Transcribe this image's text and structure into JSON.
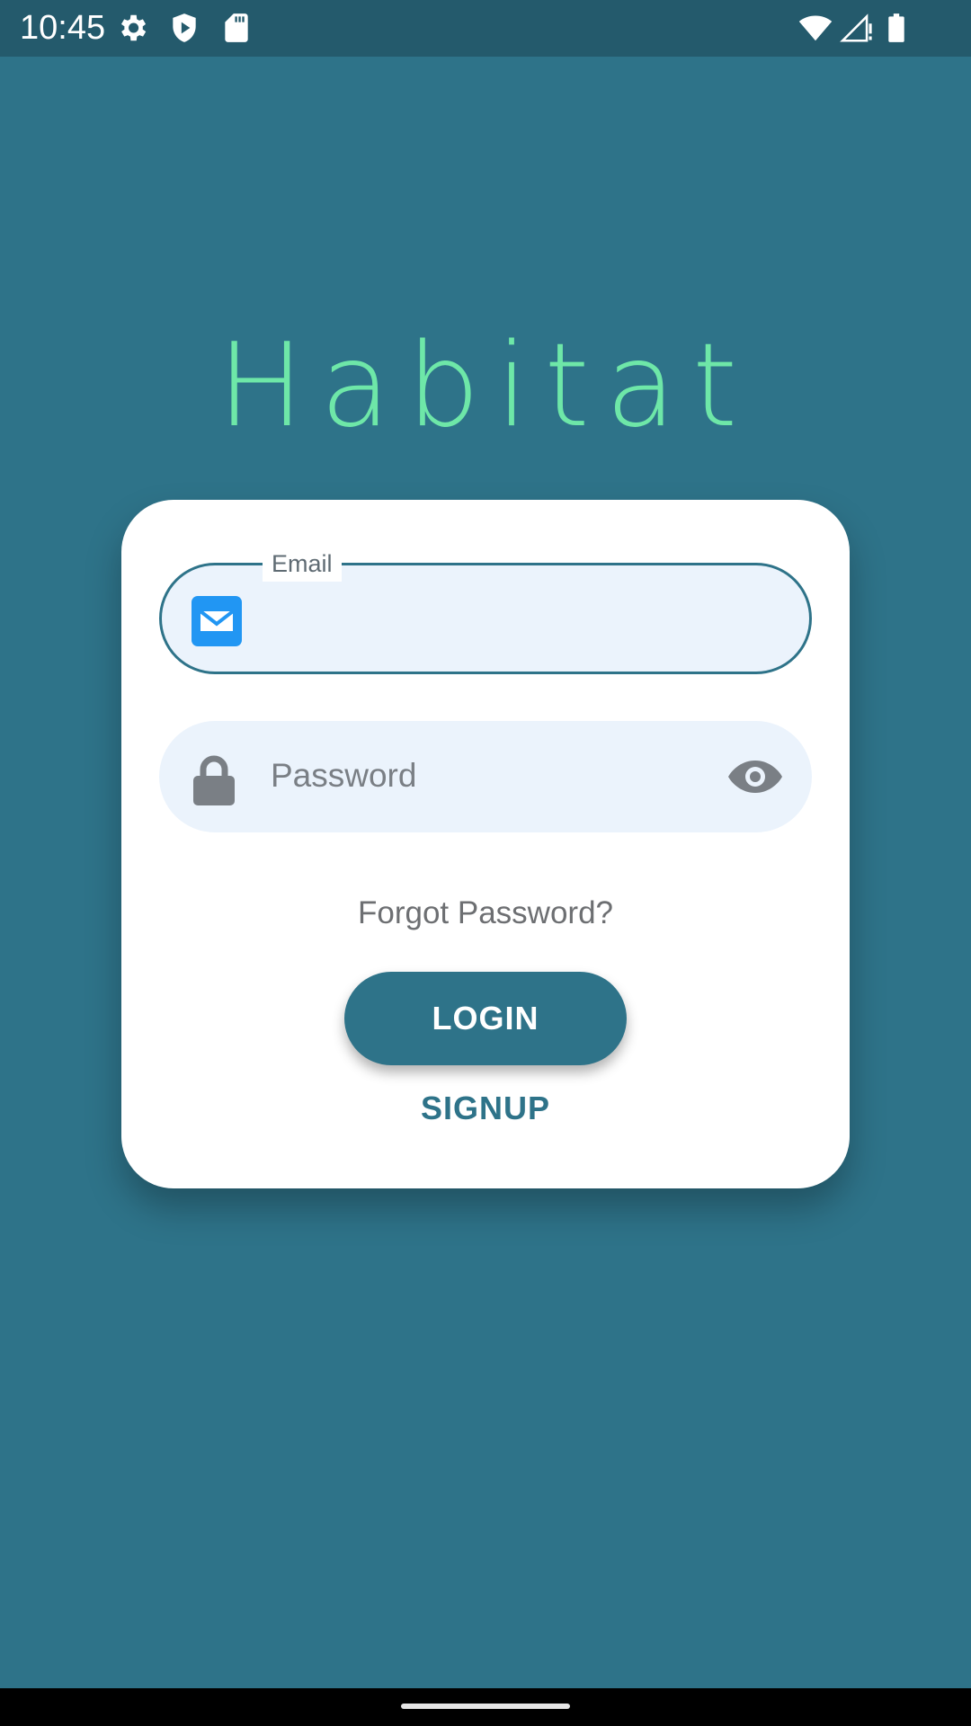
{
  "status_bar": {
    "time": "10:45",
    "icons": [
      "settings-icon",
      "shield-play-icon",
      "sd-card-icon",
      "wifi-icon",
      "cell-signal-icon",
      "battery-icon"
    ]
  },
  "app": {
    "title": "Habitat",
    "title_color": "#6ee7a8",
    "background_color": "#2e7389"
  },
  "login_form": {
    "email": {
      "label": "Email",
      "value": "",
      "icon": "envelope-icon",
      "icon_color": "#2196f3"
    },
    "password": {
      "placeholder": "Password",
      "icon": "lock-icon",
      "toggle_icon": "eye-icon"
    },
    "forgot_password": "Forgot Password?",
    "login_label": "LOGIN",
    "signup_label": "SIGNUP"
  }
}
